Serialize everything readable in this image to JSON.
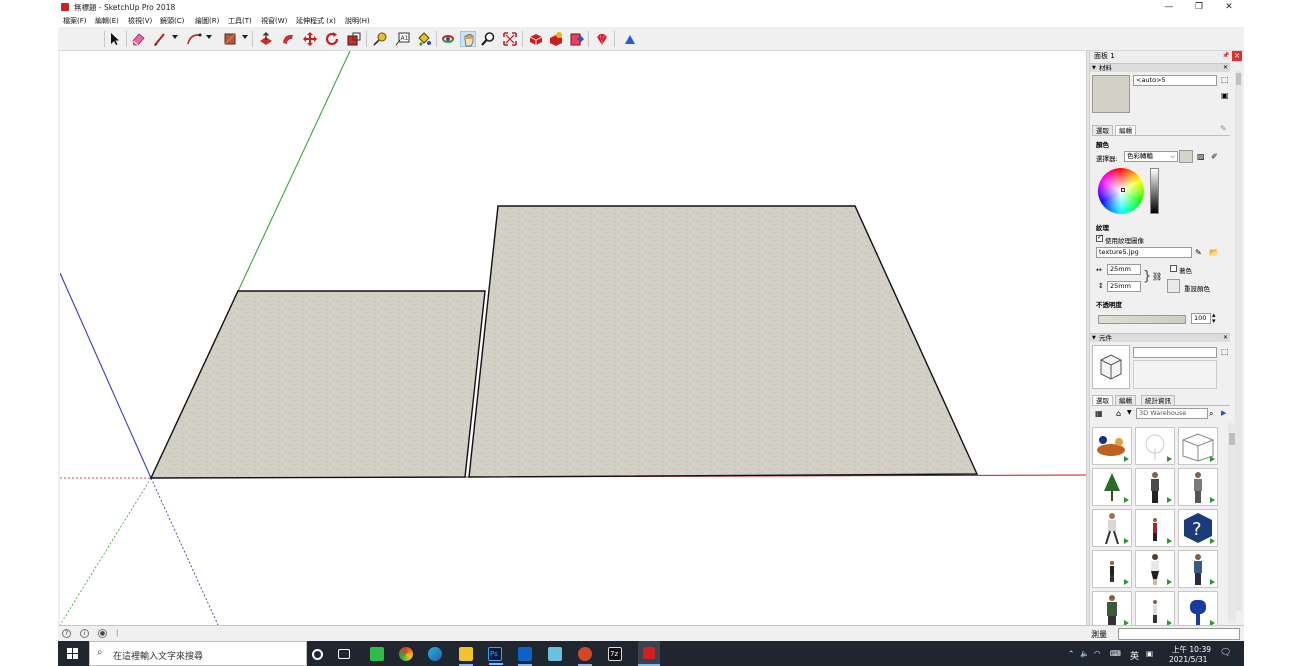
{
  "window": {
    "title": "無標題 - SketchUp Pro 2018",
    "controls": [
      "—",
      "❐",
      "✕"
    ]
  },
  "menu": [
    "檔案(F)",
    "編輯(E)",
    "檢視(V)",
    "鏡頭(C)",
    "繪圖(R)",
    "工具(T)",
    "視窗(W)",
    "延伸程式 (x)",
    "說明(H)"
  ],
  "toolbar": {
    "tools": [
      "select-tool",
      "eraser-tool",
      "line-tool",
      "arc-tool",
      "rectangle-tool",
      "push-pull-tool",
      "follow-me-tool",
      "move-tool",
      "rotate-tool",
      "scale-tool",
      "tape-measure-tool",
      "text-tool",
      "paint-bucket-tool",
      "orbit-tool",
      "pan-tool",
      "zoom-tool",
      "zoom-extents-tool",
      "warehouse-tool",
      "extension-warehouse-tool",
      "layout-tool",
      "ruby-tool",
      "section-tool"
    ],
    "active_tool": "pan-tool"
  },
  "tray": {
    "title": "面板 1",
    "materials": {
      "header": "材料",
      "name_value": "<auto>5",
      "tabs": [
        "選取",
        "編輯"
      ],
      "selected_tab": "編輯",
      "color_label": "顏色",
      "picker_label": "選擇器:",
      "picker_value": "色彩轉輪",
      "texture_label": "紋理",
      "use_texture_label": "使用紋理圖像",
      "use_texture_checked": true,
      "texture_file": "texture5.jpg",
      "width": "25mm",
      "height": "25mm",
      "colorize_label": "著色",
      "reset_label": "重設顏色",
      "opacity_label": "不透明度",
      "opacity_value": "100",
      "swatch_color": "#d6d3ca",
      "texture_color": "#d3d0c6"
    },
    "components": {
      "header": "元件",
      "tabs": [
        "選取",
        "編輯",
        "統計資訊"
      ],
      "selected_tab": "選取",
      "search_placeholder": "3D Warehouse",
      "items": [
        "car-figure",
        "tree-sketch",
        "box-outline",
        "tree",
        "person-standing",
        "person-standing",
        "person-walking",
        "person-small",
        "help-badge",
        "person-small",
        "person-woman",
        "person-man",
        "person-man",
        "person-small",
        "mailbox"
      ]
    }
  },
  "status": {
    "measure_label": "測量"
  },
  "taskbar": {
    "search_placeholder": "在這裡輸入文字來搜尋",
    "apps": [
      "cortana-icon",
      "task-view-icon",
      "line-icon",
      "chrome-icon",
      "edge-icon",
      "file-explorer-icon",
      "photoshop-icon",
      "outlook-icon",
      "app-icon",
      "powerpoint-icon",
      "sevenzip-icon",
      "sketchup-icon"
    ],
    "tray": {
      "language": "英",
      "time": "上午 10:39",
      "date": "2021/5/31"
    }
  },
  "scene": {
    "axis_colors": {
      "red": "#c81414",
      "green": "#28a028",
      "blue": "#2828c8"
    },
    "surface_color": "#d3d0c6",
    "edge_color": "#111111"
  }
}
